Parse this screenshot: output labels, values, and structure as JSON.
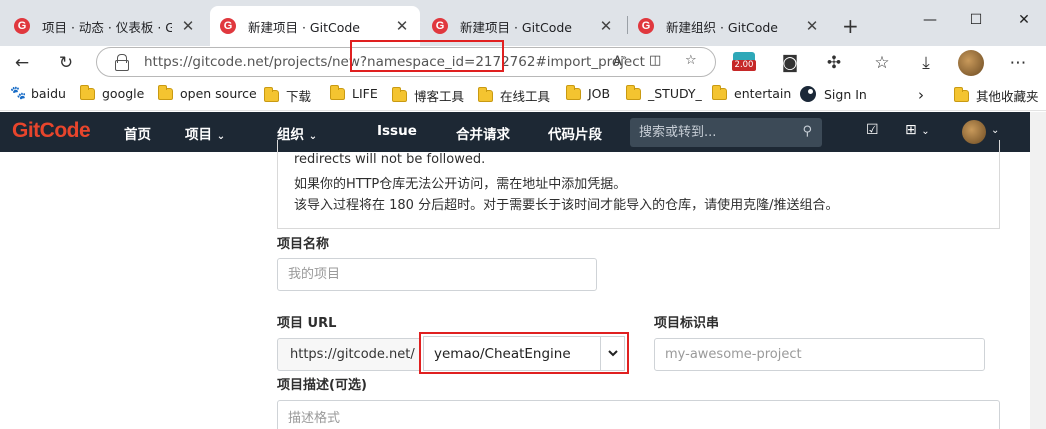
{
  "browser": {
    "tabs": [
      {
        "title": "项目 · 动态 · 仪表板 · GitCode"
      },
      {
        "title": "新建项目 · GitCode"
      },
      {
        "title": "新建项目 · GitCode"
      },
      {
        "title": "新建组织 · GitCode"
      }
    ],
    "url": "https://gitcode.net/projects/new?namespace_id=2172762#import_project",
    "extension_badge": "2.00",
    "bookmarks": [
      "baidu",
      "google",
      "open source",
      "下载",
      "LIFE",
      "博客工具",
      "在线工具",
      "JOB",
      "_STUDY_",
      "entertain",
      "Sign In"
    ],
    "other_bookmarks": "其他收藏夹"
  },
  "site": {
    "logo": "GitCode",
    "nav": {
      "home": "首页",
      "projects": "项目",
      "groups": "组织",
      "issue": "Issue",
      "merge_requests": "合并请求",
      "snippets": "代码片段"
    },
    "search_placeholder": "搜索或转到..."
  },
  "form": {
    "info_lines": [
      "redirects will not be followed.",
      "如果你的HTTP仓库无法公开访问，需在地址中添加凭据。",
      "该导入过程将在 180 分后超时。对于需要长于该时间才能导入的仓库，请使用克隆/推送组合。"
    ],
    "project_name_label": "项目名称",
    "project_name_placeholder": "我的项目",
    "project_url_label": "项目 URL",
    "url_prefix": "https://gitcode.net/",
    "namespace_value": "yemao/CheatEngine",
    "slug_label": "项目标识串",
    "slug_placeholder": "my-awesome-project",
    "description_label": "项目描述(可选)",
    "description_placeholder": "描述格式"
  },
  "colors": {
    "nav_bg": "#1d2834",
    "logo": "#e8452c",
    "highlight": "#e02020"
  }
}
